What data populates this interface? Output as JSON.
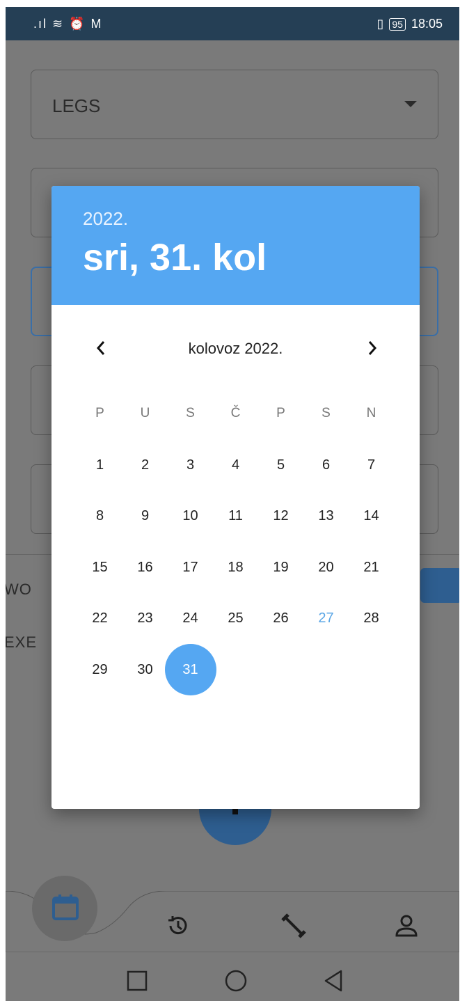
{
  "status_bar": {
    "left_icons": ".ıl ≋ ⏰ M",
    "battery": "95",
    "time": "18:05"
  },
  "background": {
    "muscle_group": "LEGS",
    "label_workout": "WO",
    "label_exercise": "EXE"
  },
  "dialog": {
    "year": "2022.",
    "selected_date": "sri, 31. kol",
    "month_label": "kolovoz 2022.",
    "weekdays": [
      "P",
      "U",
      "S",
      "Č",
      "P",
      "S",
      "N"
    ],
    "days": [
      [
        "1",
        "2",
        "3",
        "4",
        "5",
        "6",
        "7"
      ],
      [
        "8",
        "9",
        "10",
        "11",
        "12",
        "13",
        "14"
      ],
      [
        "15",
        "16",
        "17",
        "18",
        "19",
        "20",
        "21"
      ],
      [
        "22",
        "23",
        "24",
        "25",
        "26",
        "27",
        "28"
      ],
      [
        "29",
        "30",
        "31",
        "",
        "",
        "",
        ""
      ]
    ],
    "today": "27",
    "selected": "31",
    "colors": {
      "header": "#55a7f2",
      "today": "#5aa6e6",
      "selected": "#55a7f2"
    }
  },
  "bottom_nav": {
    "items": [
      "calendar-icon",
      "history-icon",
      "dumbbell-icon",
      "profile-icon"
    ]
  }
}
